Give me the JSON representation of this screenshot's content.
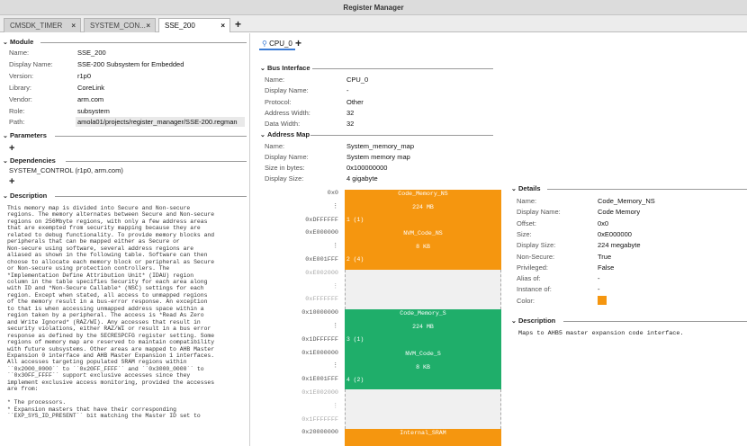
{
  "window": {
    "title": "Register Manager"
  },
  "tabs": [
    {
      "label": "CMSDK_TIMER",
      "close": "×"
    },
    {
      "label": "SYSTEM_CON...",
      "close": "×"
    },
    {
      "label": "SSE_200",
      "close": "×"
    }
  ],
  "tab_add": "+",
  "module": {
    "header": "Module",
    "fields": [
      {
        "label": "Name:",
        "value": "SSE_200"
      },
      {
        "label": "Display Name:",
        "value": "SSE-200 Subsystem for Embedded"
      },
      {
        "label": "Version:",
        "value": "r1p0"
      },
      {
        "label": "Library:",
        "value": "CoreLink"
      },
      {
        "label": "Vendor:",
        "value": "arm.com"
      },
      {
        "label": "Role:",
        "value": "subsystem"
      },
      {
        "label": "Path:",
        "value": "amola01/projects/register_manager/SSE-200.regman"
      }
    ]
  },
  "parameters": {
    "header": "Parameters",
    "add": "+"
  },
  "dependencies": {
    "header": "Dependencies",
    "item": "SYSTEM_CONTROL (r1p0, arm.com)",
    "add": "+"
  },
  "description": {
    "header": "Description",
    "text": "This memory map is divided into Secure and Non-secure\nregions. The memory alternates between Secure and Non-secure\nregions on 256Mbyte regions, with only a few address areas\nthat are exempted from security mapping because they are\nrelated to debug functionality. To provide memory blocks and\nperipherals that can be mapped either as Secure or\nNon-secure using software, several address regions are\naliased as shown in the following table. Software can then\nchoose to allocate each memory block or peripheral as Secure\nor Non-secure using protection controllers. The\n*Implementation Define Attribution Unit* (IDAU) region\ncolumn in the table specifies Security for each area along\nwith ID and *Non-Secure Callable* (NSC) settings for each\nregion. Except when stated, all access to unmapped regions\nof the memory result in a bus-error response. An exception\nto that is when accessing unmapped address space within a\nregion taken by a peripheral. The access is *Read As Zero\nand Write Ignored* (RAZ/WI). Any accesses that result in\nsecurity violations, either RAZ/WI or result in a bus error\nresponse as defined by the SECRESPCFG register setting. Some\nregions of memory map are reserved to maintain compatibility\nwith future subsystems. Other areas are mapped to AHB Master\nExpansion 0 interface and AHB Master Expansion 1 interfaces.\nAll accesses targeting populated SRAM regions within\n``0x2000_0000`` to ``0x20FF_FFFF`` and ``0x3000_0000`` to\n``0x30FF_FFFF`` support exclusive accesses since they\nimplement exclusive access monitoring, provided the accesses\nare from:\n\n* The processors.\n* Expansion masters that have their corresponding\n``EXP_SYS_ID_PRESENT`` bit matching the Master ID set to"
  },
  "cpu_tab": {
    "icon": "hub-icon",
    "label": "CPU_0",
    "add": "+"
  },
  "bus_interface": {
    "header": "Bus Interface",
    "fields": [
      {
        "label": "Name:",
        "value": "CPU_0"
      },
      {
        "label": "Display Name:",
        "value": "-"
      },
      {
        "label": "Protocol:",
        "value": "Other"
      },
      {
        "label": "Address Width:",
        "value": "32"
      },
      {
        "label": "Data Width:",
        "value": "32"
      }
    ]
  },
  "address_map": {
    "header": "Address Map",
    "fields": [
      {
        "label": "Name:",
        "value": "System_memory_map"
      },
      {
        "label": "Display Name:",
        "value": "System memory map"
      },
      {
        "label": "Size in bytes:",
        "value": "0x100000000"
      },
      {
        "label": "Display Size:",
        "value": "4 gigabyte"
      }
    ]
  },
  "memory_map": {
    "addresses": [
      "0x0",
      "",
      "0xDFFFFFF",
      "0xE000000",
      "",
      "0xE001FFF",
      "0xE002000",
      "",
      "0xFFFFFFF",
      "0x10000000",
      "",
      "0x1DFFFFFF",
      "0x1E000000",
      "",
      "0x1E001FFF",
      "0x1E002000",
      "",
      "0x1FFFFFFF",
      "0x20000000"
    ],
    "blocks": [
      {
        "name": "Code_Memory_NS",
        "size": "224 MB",
        "index": "1 (1)",
        "color": "#f5960f",
        "kind": "region"
      },
      {
        "name": "NVM_Code_NS",
        "size": "8 KB",
        "index": "2 (4)",
        "color": "#f5960f",
        "kind": "region"
      },
      {
        "name": "",
        "size": "",
        "index": "",
        "color": "#f0f0f0",
        "kind": "gap"
      },
      {
        "name": "Code_Memory_S",
        "size": "224 MB",
        "index": "3 (1)",
        "color": "#1fae6a",
        "kind": "region"
      },
      {
        "name": "NVM_Code_S",
        "size": "8 KB",
        "index": "4 (2)",
        "color": "#1fae6a",
        "kind": "region"
      },
      {
        "name": "",
        "size": "",
        "index": "",
        "color": "#f0f0f0",
        "kind": "gap"
      },
      {
        "name": "Internal_SRAM",
        "size": "",
        "index": "",
        "color": "#f5960f",
        "kind": "region"
      }
    ]
  },
  "details": {
    "header": "Details",
    "fields": [
      {
        "label": "Name:",
        "value": "Code_Memory_NS"
      },
      {
        "label": "Display Name:",
        "value": "Code Memory"
      },
      {
        "label": "Offset:",
        "value": "0x0"
      },
      {
        "label": "Size:",
        "value": "0xE000000"
      },
      {
        "label": "Display Size:",
        "value": "224 megabyte"
      },
      {
        "label": "Non-Secure:",
        "value": "True"
      },
      {
        "label": "Privileged:",
        "value": "False"
      },
      {
        "label": "Alias of:",
        "value": "-"
      },
      {
        "label": "Instance of:",
        "value": "-"
      },
      {
        "label": "Color:",
        "value": ""
      }
    ],
    "color": "#f5960f"
  },
  "details_description": {
    "header": "Description",
    "text": "Maps to AHB5 master expansion code interface."
  }
}
